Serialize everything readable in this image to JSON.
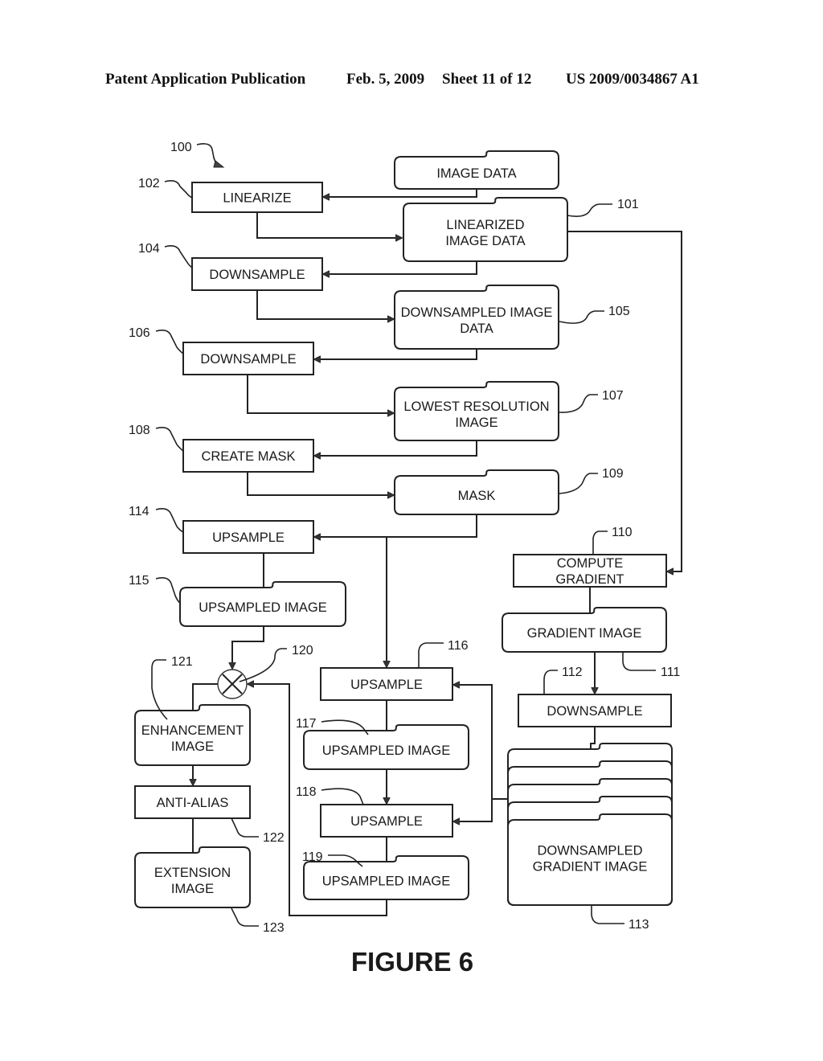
{
  "header": {
    "publication": "Patent Application Publication",
    "date": "Feb. 5, 2009",
    "sheet": "Sheet 11 of 12",
    "number": "US 2009/0034867 A1"
  },
  "figure": {
    "title": "FIGURE 6",
    "ref": "100"
  },
  "nodes": {
    "n102": {
      "label": [
        "LINEARIZE"
      ],
      "ref": "102",
      "kind": "process"
    },
    "n_image_data": {
      "label": [
        "IMAGE DATA"
      ],
      "ref": "",
      "kind": "data"
    },
    "n101": {
      "label": [
        "LINEARIZED",
        "IMAGE DATA"
      ],
      "ref": "101",
      "kind": "data"
    },
    "n104": {
      "label": [
        "DOWNSAMPLE"
      ],
      "ref": "104",
      "kind": "process"
    },
    "n105": {
      "label": [
        "DOWNSAMPLED IMAGE",
        "DATA"
      ],
      "ref": "105",
      "kind": "data"
    },
    "n106": {
      "label": [
        "DOWNSAMPLE"
      ],
      "ref": "106",
      "kind": "process"
    },
    "n107": {
      "label": [
        "LOWEST RESOLUTION",
        "IMAGE"
      ],
      "ref": "107",
      "kind": "data"
    },
    "n108": {
      "label": [
        "CREATE MASK"
      ],
      "ref": "108",
      "kind": "process"
    },
    "n109": {
      "label": [
        "MASK"
      ],
      "ref": "109",
      "kind": "data"
    },
    "n114": {
      "label": [
        "UPSAMPLE"
      ],
      "ref": "114",
      "kind": "process"
    },
    "n115": {
      "label": [
        "UPSAMPLED IMAGE"
      ],
      "ref": "115",
      "kind": "data"
    },
    "n110": {
      "label": [
        "COMPUTE",
        "GRADIENT"
      ],
      "ref": "110",
      "kind": "process"
    },
    "n111": {
      "label": [
        "GRADIENT IMAGE"
      ],
      "ref": "111",
      "kind": "data"
    },
    "n112": {
      "label": [
        "DOWNSAMPLE"
      ],
      "ref": "112",
      "kind": "process"
    },
    "n113": {
      "label": [
        "DOWNSAMPLED",
        "GRADIENT IMAGE"
      ],
      "ref": "113",
      "kind": "data-stack"
    },
    "n116": {
      "label": [
        "UPSAMPLE"
      ],
      "ref": "116",
      "kind": "process"
    },
    "n117": {
      "label": [
        "UPSAMPLED IMAGE"
      ],
      "ref": "117",
      "kind": "data"
    },
    "n118": {
      "label": [
        "UPSAMPLE"
      ],
      "ref": "118",
      "kind": "process"
    },
    "n119": {
      "label": [
        "UPSAMPLED IMAGE"
      ],
      "ref": "119",
      "kind": "data"
    },
    "n120": {
      "label": [],
      "ref": "120",
      "kind": "multiply"
    },
    "n121": {
      "label": [
        "ENHANCEMENT",
        "IMAGE"
      ],
      "ref": "121",
      "kind": "data"
    },
    "n122": {
      "label": [
        "ANTI-ALIAS"
      ],
      "ref": "122",
      "kind": "process"
    },
    "n123": {
      "label": [
        "EXTENSION",
        "IMAGE"
      ],
      "ref": "123",
      "kind": "data"
    }
  },
  "edges": [
    [
      "n_image_data",
      "n102"
    ],
    [
      "n102",
      "n101"
    ],
    [
      "n101",
      "n104"
    ],
    [
      "n101",
      "n110"
    ],
    [
      "n104",
      "n105"
    ],
    [
      "n105",
      "n106"
    ],
    [
      "n106",
      "n107"
    ],
    [
      "n107",
      "n108"
    ],
    [
      "n108",
      "n109"
    ],
    [
      "n109",
      "n114"
    ],
    [
      "n109",
      "n116"
    ],
    [
      "n114",
      "n115"
    ],
    [
      "n115",
      "n120"
    ],
    [
      "n119",
      "n120"
    ],
    [
      "n120",
      "n121"
    ],
    [
      "n121",
      "n122"
    ],
    [
      "n122",
      "n123"
    ],
    [
      "n110",
      "n111"
    ],
    [
      "n111",
      "n112"
    ],
    [
      "n112",
      "n113"
    ],
    [
      "n113",
      "n116"
    ],
    [
      "n113",
      "n118"
    ],
    [
      "n116",
      "n117"
    ],
    [
      "n117",
      "n118"
    ],
    [
      "n118",
      "n119"
    ]
  ]
}
